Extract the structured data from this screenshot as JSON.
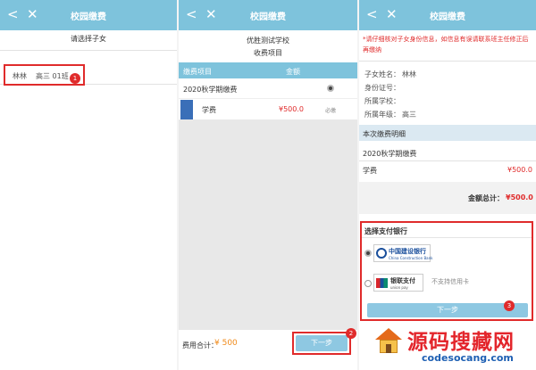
{
  "panel1": {
    "nav_back": "<",
    "nav_close": "✕",
    "title": "校园缴费",
    "prompt": "请选择子女",
    "child": {
      "name": "林林",
      "class": "高三 01班"
    },
    "badge": "1"
  },
  "panel2": {
    "nav_back": "<",
    "nav_close": "✕",
    "title": "校园缴费",
    "school": "优胜测试学校",
    "subtitle": "收费项目",
    "col_item": "缴费项目",
    "col_amount": "金额",
    "group": "2020秋学期缴费",
    "item": {
      "name": "学费",
      "amount": "¥500.0",
      "tag": "必缴"
    },
    "total_label": "费用合计：",
    "total_value": "¥ 500",
    "next_button": "下一步",
    "badge": "2"
  },
  "panel3": {
    "nav_back": "<",
    "nav_close": "✕",
    "title": "校园缴费",
    "notice": "*请仔细核对子女身份信息，如信息有误请联系班主任修正后再缴纳",
    "name_label": "子女姓名：",
    "name_value": "林林",
    "id_label": "身份证号：",
    "school_label": "所属学校：",
    "grade_label": "所属年级：",
    "grade_value": "高三",
    "detail_header": "本次缴费明细",
    "group": "2020秋学期缴费",
    "item": {
      "name": "学费",
      "amount": "¥500.0"
    },
    "total_label": "金额总计：",
    "total_value": "¥500.0",
    "bank_header": "选择支付银行",
    "bank1_text": "中国建设银行",
    "bank1_sub": "China Construction Bank",
    "bank2_text": "银联支付",
    "bank2_sub": "union pay",
    "bank2_note": "不支持信用卡",
    "next_button": "下一步",
    "badge": "3"
  },
  "watermark": {
    "main": "源码搜藏网",
    "sub": "codesocang.com"
  },
  "colors": {
    "nav": "#7ec3dc",
    "accent_red": "#e02b2b",
    "button": "#8ec8e2",
    "ccb_blue": "#1a4f9c"
  }
}
